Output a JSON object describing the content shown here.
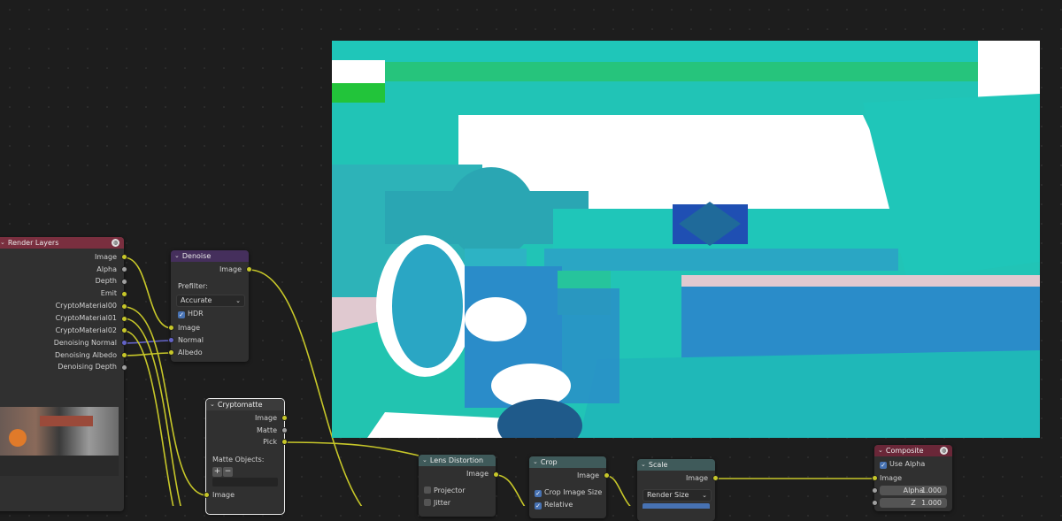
{
  "render_layers": {
    "title": "Render Layers",
    "outputs": [
      "Image",
      "Alpha",
      "Depth",
      "Emit",
      "CryptoMaterial00",
      "CryptoMaterial01",
      "CryptoMaterial02",
      "Denoising Normal",
      "Denoising Albedo",
      "Denoising Depth"
    ]
  },
  "denoise": {
    "title": "Denoise",
    "output": "Image",
    "prefilter_label": "Prefilter:",
    "prefilter_value": "Accurate",
    "hdr_label": "HDR",
    "inputs": [
      "Image",
      "Normal",
      "Albedo"
    ]
  },
  "cryptomatte": {
    "title": "Cryptomatte",
    "outputs": [
      "Image",
      "Matte",
      "Pick"
    ],
    "matte_objects_label": "Matte Objects:",
    "add": "+",
    "remove": "−",
    "input": "Image"
  },
  "lens_distortion": {
    "title": "Lens Distortion",
    "output": "Image",
    "options": [
      "Projector",
      "Jitter"
    ]
  },
  "crop": {
    "title": "Crop",
    "output": "Image",
    "options": [
      "Crop Image Size",
      "Relative"
    ]
  },
  "scale": {
    "title": "Scale",
    "output": "Image",
    "mode": "Render Size"
  },
  "composite": {
    "title": "Composite",
    "use_alpha": "Use Alpha",
    "input": "Image",
    "alpha_label": "Alpha",
    "alpha_value": "1.000",
    "z_label": "Z",
    "z_value": "1.000"
  },
  "colors": {
    "render_layers_header": "#7a2f3f",
    "denoise_header": "#452f5c",
    "cryptomatte_header": "#3b3b3b",
    "filter_header": "#3f5a5a",
    "composite_header": "#6a2738",
    "image_socket": "#c7c729",
    "vector_socket": "#6363c7",
    "float_socket": "#a1a1a1"
  }
}
